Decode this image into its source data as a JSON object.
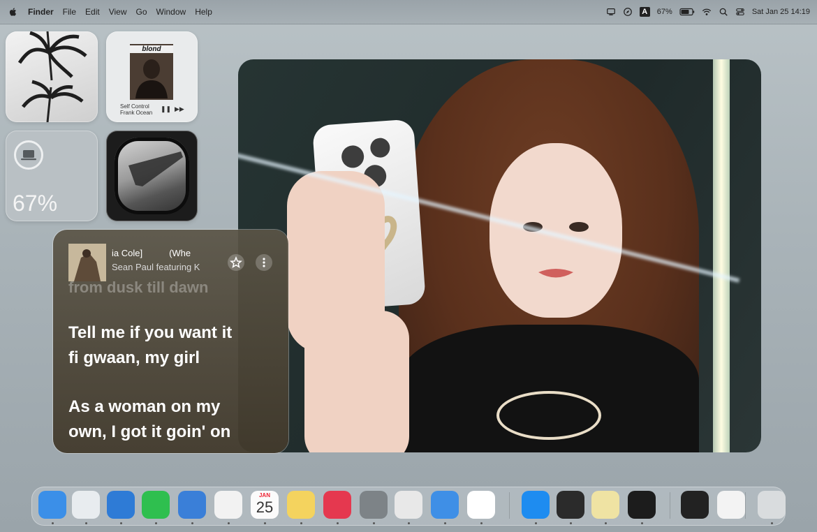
{
  "menubar": {
    "apple_icon": "apple-logo",
    "items": [
      "Finder",
      "File",
      "Edit",
      "View",
      "Go",
      "Window",
      "Help"
    ],
    "status_icons": [
      "screen-mirroring-icon",
      "compass-icon",
      "input-source-icon"
    ],
    "input_source": "A",
    "battery_text": "67%",
    "battery_icon": "battery-icon",
    "wifi_icon": "wifi-icon",
    "spotlight_icon": "search-icon",
    "control_center_icon": "control-center-icon",
    "datetime": "Sat Jan 25  14:19"
  },
  "widgets": {
    "album": {
      "title": "blond",
      "track": "Self Control",
      "artist": "Frank Ocean"
    },
    "battery": {
      "percent": "67%",
      "icon": "laptop-icon"
    }
  },
  "lyrics": {
    "song_title_left": "ia Cole]",
    "song_title_right": "(Whe",
    "artist": "Sean Paul featuring K",
    "faded_line": "from dusk till dawn",
    "lines": [
      "Tell me if you want it",
      "fi gwaan, my girl",
      "As a woman on my",
      "own, I got it goin' on"
    ],
    "star_icon": "star-icon",
    "more_icon": "more-icon"
  },
  "dock": {
    "apps": [
      {
        "name": "finder",
        "color": "#3b8fe8"
      },
      {
        "name": "launchpad",
        "color": "#e8ecef"
      },
      {
        "name": "safari",
        "color": "#2e7bd6"
      },
      {
        "name": "messages",
        "color": "#2fbf4f"
      },
      {
        "name": "mail",
        "color": "#3a7fd8"
      },
      {
        "name": "photos",
        "color": "#f2f2f2"
      },
      {
        "name": "calendar",
        "color": "#fbfbfb"
      },
      {
        "name": "notes",
        "color": "#f4d35e"
      },
      {
        "name": "music",
        "color": "#e5384f"
      },
      {
        "name": "system-preferences",
        "color": "#7d8387"
      },
      {
        "name": "iphone-mirroring",
        "color": "#e8e8e8"
      },
      {
        "name": "icloud-drive",
        "color": "#3f8fe6"
      },
      {
        "name": "chrome",
        "color": "#ffffff"
      },
      {
        "name": "app-store",
        "color": "#1e8cf0"
      },
      {
        "name": "quicktime",
        "color": "#2b2b2b"
      },
      {
        "name": "stickies",
        "color": "#efe3a3"
      },
      {
        "name": "screen-saver",
        "color": "#1c1c1c"
      },
      {
        "name": "folder-window-1",
        "color": "#222222"
      },
      {
        "name": "folder-window-2",
        "color": "#f3f3f3"
      },
      {
        "name": "trash",
        "color": "#d9dcde"
      }
    ],
    "calendar_month": "JAN",
    "calendar_day": "25"
  }
}
